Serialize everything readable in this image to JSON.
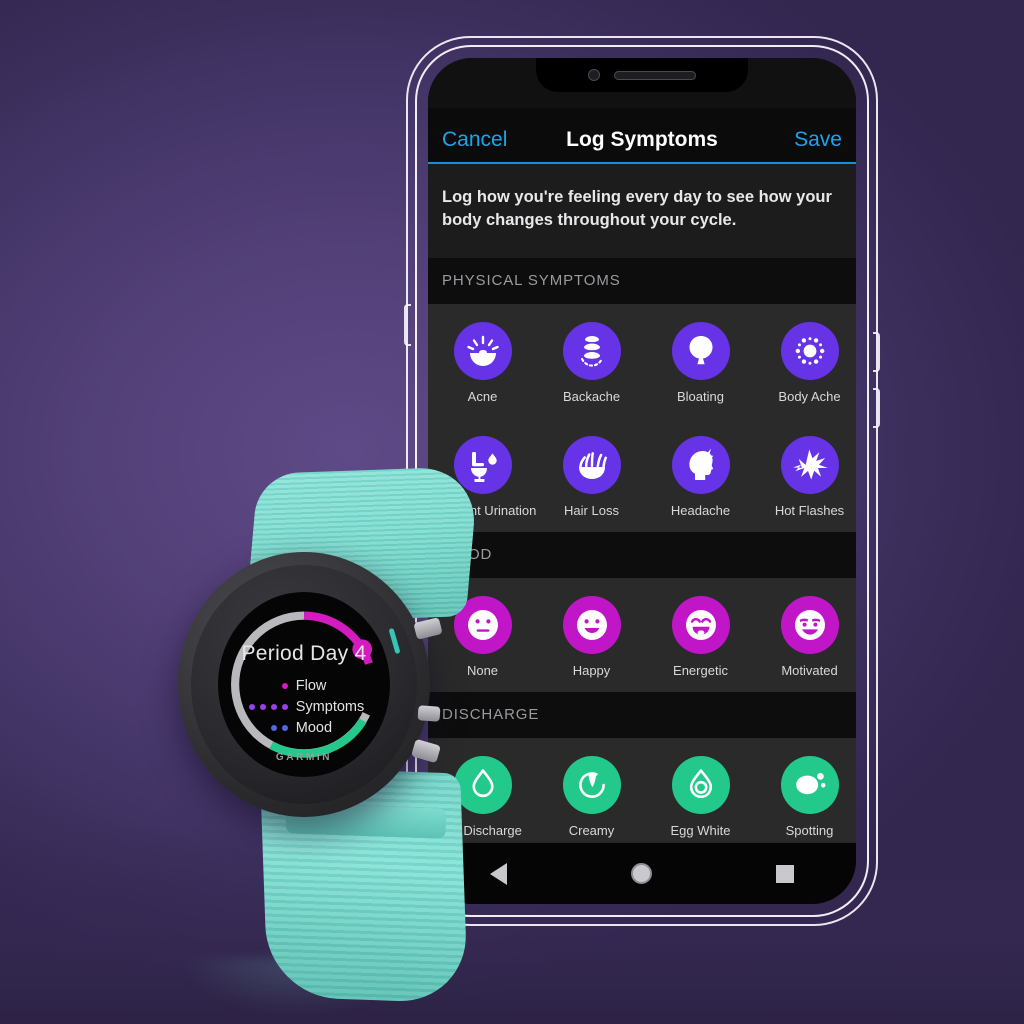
{
  "scene": {
    "background_color_outer": "#332750",
    "background_color_inner": "#5e4a86"
  },
  "phone": {
    "notch": {
      "camera_icon": "camera-dot-icon",
      "speaker_icon": "speaker-slot-icon"
    },
    "android_nav": {
      "back_icon": "back-triangle-icon",
      "home_icon": "home-circle-icon",
      "recents_icon": "recents-square-icon"
    }
  },
  "app": {
    "nav": {
      "cancel_label": "Cancel",
      "title": "Log Symptoms",
      "save_label": "Save",
      "accent_color": "#1ba5e8"
    },
    "intro_text": "Log how you're feeling every day to see how your body changes throughout your cycle.",
    "sections": [
      {
        "header": "PHYSICAL SYMPTOMS",
        "color": "#6633e6",
        "rows": [
          [
            {
              "label": "Acne",
              "icon": "acne-icon"
            },
            {
              "label": "Backache",
              "icon": "backache-spine-icon"
            },
            {
              "label": "Bloating",
              "icon": "bloating-balloon-icon"
            },
            {
              "label": "Body Ache",
              "icon": "body-ache-radiate-icon"
            }
          ],
          [
            {
              "label": "Frequent Urination",
              "icon": "toilet-drop-icon"
            },
            {
              "label": "Hair Loss",
              "icon": "hair-loss-icon"
            },
            {
              "label": "Headache",
              "icon": "headache-head-icon"
            },
            {
              "label": "Hot Flashes",
              "icon": "hot-flash-burst-icon"
            }
          ]
        ]
      },
      {
        "header": "MOOD",
        "color": "#c016c8",
        "rows": [
          [
            {
              "label": "None",
              "icon": "face-neutral-icon"
            },
            {
              "label": "Happy",
              "icon": "face-smile-icon"
            },
            {
              "label": "Energetic",
              "icon": "face-energetic-icon"
            },
            {
              "label": "Motivated",
              "icon": "face-motivated-icon"
            }
          ]
        ]
      },
      {
        "header": "DISCHARGE",
        "color": "#22c98a",
        "rows": [
          [
            {
              "label": "No Discharge",
              "icon": "droplet-outline-icon"
            },
            {
              "label": "Creamy",
              "icon": "creamy-swirl-icon"
            },
            {
              "label": "Egg White",
              "icon": "egg-white-icon"
            },
            {
              "label": "Spotting",
              "icon": "spotting-blob-icon"
            }
          ]
        ]
      }
    ]
  },
  "watch": {
    "brand": "GARMIN",
    "screen_title": "Period Day 4",
    "legend": [
      {
        "label": "Flow",
        "dots": 1,
        "color": "#d41bc0"
      },
      {
        "label": "Symptoms",
        "dots": 4,
        "color": "#9b3fe8"
      },
      {
        "label": "Mood",
        "dots": 2,
        "color": "#5566e0"
      }
    ],
    "ring": {
      "track_color": "#b9b9bd",
      "flow_color": "#d41bc0",
      "mood_color": "#22c98a",
      "marker_color": "#d41bc0"
    },
    "band_color": "#7fdecf"
  }
}
